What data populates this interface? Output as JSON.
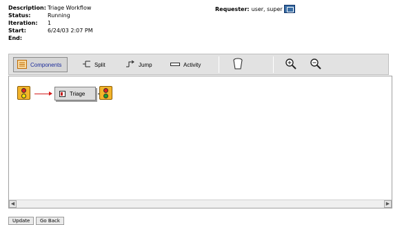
{
  "info": {
    "description_label": "Description:",
    "description_value": "Triage Workflow",
    "status_label": "Status:",
    "status_value": "Running",
    "iteration_label": "Iteration:",
    "iteration_value": "1",
    "start_label": "Start:",
    "start_value": "6/24/03 2:07 PM",
    "end_label": "End:",
    "end_value": ""
  },
  "requester": {
    "label": "Requester:",
    "value": "user, super",
    "icon": "user-card-icon"
  },
  "toolbar": {
    "components_label": "Components",
    "split_label": "Split",
    "jump_label": "Jump",
    "activity_label": "Activity",
    "icons": [
      "components-icon",
      "split-icon",
      "jump-icon",
      "activity-icon",
      "trash-icon",
      "zoom-in-icon",
      "zoom-out-icon"
    ]
  },
  "workflow": {
    "start_node": "traffic-light-icon",
    "task_label": "Triage",
    "end_node": "traffic-light-icon"
  },
  "buttons": {
    "update_label": "Update",
    "go_back_label": "Go Back"
  },
  "colors": {
    "toolbar_bg": "#e2e2e2",
    "active_label": "#1a2a9a",
    "light_body": "#f3b42b",
    "red_light": "#e02020",
    "green_light": "#1fa12a",
    "connector_red": "#d41a1a"
  }
}
